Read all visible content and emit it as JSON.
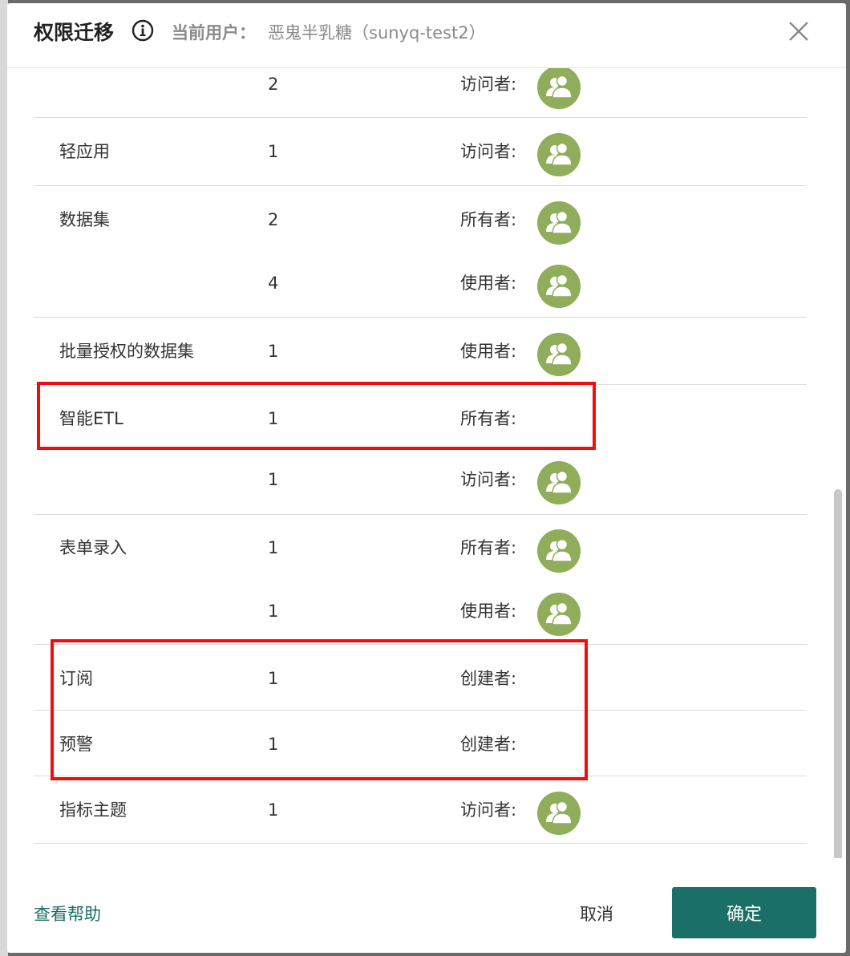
{
  "dialog": {
    "title": "权限迁移",
    "current_user_label": "当前用户：",
    "current_user_value": "恶鬼半乳糖（sunyq-test2）"
  },
  "rows": [
    {
      "name": "",
      "count": "2",
      "role": "访问者:",
      "has_avatar": true
    },
    {
      "name": "轻应用",
      "count": "1",
      "role": "访问者:",
      "has_avatar": true
    },
    {
      "name": "数据集",
      "count": "2",
      "role": "所有者:",
      "has_avatar": true
    },
    {
      "name": "",
      "count": "4",
      "role": "使用者:",
      "has_avatar": true
    },
    {
      "name": "批量授权的数据集",
      "count": "1",
      "role": "使用者:",
      "has_avatar": true
    },
    {
      "name": "智能ETL",
      "count": "1",
      "role": "所有者:",
      "has_avatar": false
    },
    {
      "name": "",
      "count": "1",
      "role": "访问者:",
      "has_avatar": true
    },
    {
      "name": "表单录入",
      "count": "1",
      "role": "所有者:",
      "has_avatar": true
    },
    {
      "name": "",
      "count": "1",
      "role": "使用者:",
      "has_avatar": true
    },
    {
      "name": "订阅",
      "count": "1",
      "role": "创建者:",
      "has_avatar": false
    },
    {
      "name": "预警",
      "count": "1",
      "role": "创建者:",
      "has_avatar": false
    },
    {
      "name": "指标主题",
      "count": "1",
      "role": "访问者:",
      "has_avatar": true
    }
  ],
  "footer": {
    "help_label": "查看帮助",
    "cancel_label": "取消",
    "confirm_label": "确定"
  },
  "colors": {
    "accent": "#1a7066",
    "avatar": "#8fad5a",
    "highlight_box": "#f20d0d"
  },
  "icons": {
    "info": "info-circle-icon",
    "close": "close-icon",
    "avatar": "user-group-avatar-icon"
  }
}
